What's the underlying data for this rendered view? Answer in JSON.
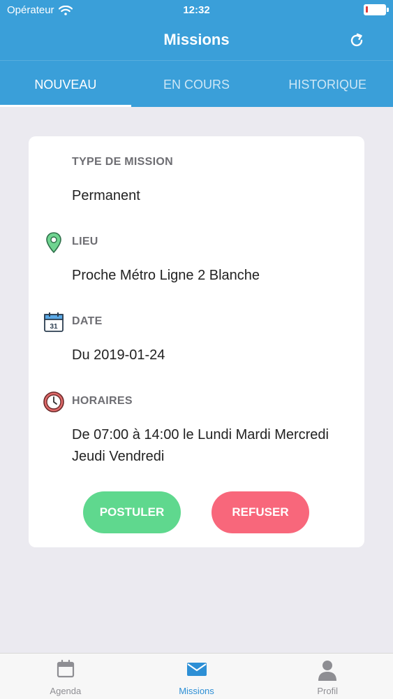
{
  "status_bar": {
    "carrier": "Opérateur",
    "time": "12:32",
    "battery_level": 0.12
  },
  "header": {
    "title": "Missions",
    "refresh_icon": "refresh-icon"
  },
  "tabs": [
    {
      "label": "NOUVEAU",
      "active": true
    },
    {
      "label": "EN COURS",
      "active": false
    },
    {
      "label": "HISTORIQUE",
      "active": false
    }
  ],
  "mission": {
    "type": {
      "label": "TYPE DE MISSION",
      "value": "Permanent"
    },
    "location": {
      "label": "LIEU",
      "value": "Proche Métro Ligne 2 Blanche",
      "icon": "map-pin-icon"
    },
    "date": {
      "label": "DATE",
      "value": "Du 2019-01-24",
      "icon": "calendar-icon",
      "calendar_day": "31"
    },
    "hours": {
      "label": "HORAIRES",
      "value": "De 07:00 à 14:00 le Lundi Mardi Mercredi Jeudi Vendredi",
      "icon": "clock-icon"
    },
    "actions": {
      "apply_label": "POSTULER",
      "refuse_label": "REFUSER"
    }
  },
  "tab_bar": [
    {
      "label": "Agenda",
      "icon": "calendar-icon",
      "active": false
    },
    {
      "label": "Missions",
      "icon": "envelope-icon",
      "active": true
    },
    {
      "label": "Profil",
      "icon": "user-icon",
      "active": false
    }
  ],
  "colors": {
    "primary": "#3a9fd9",
    "apply": "#5fd88e",
    "refuse": "#f8677b",
    "background": "#ebeaf0"
  }
}
